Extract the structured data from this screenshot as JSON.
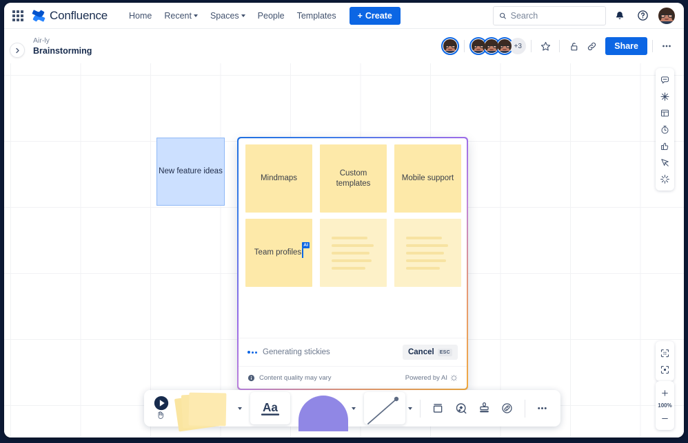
{
  "nav": {
    "brand": "Confluence",
    "apps_icon": "apps-grid-icon",
    "links": [
      {
        "label": "Home",
        "has_caret": false
      },
      {
        "label": "Recent",
        "has_caret": true
      },
      {
        "label": "Spaces",
        "has_caret": true
      },
      {
        "label": "People",
        "has_caret": false
      },
      {
        "label": "Templates",
        "has_caret": false
      }
    ],
    "create_label": "Create",
    "search_placeholder": "Search",
    "search_value": "",
    "notification_icon": "bell-icon",
    "help_icon": "help-icon",
    "profile_icon": "avatar"
  },
  "subheader": {
    "expand_icon": "chevron-right-icon",
    "breadcrumb": "Air-ly",
    "title": "Brainstorming",
    "collaborator_count_badge": "+3",
    "star_icon": "star-icon",
    "restrictions_icon": "lock-icon",
    "copy_link_icon": "link-icon",
    "share_label": "Share",
    "more_icon": "more-horizontal-icon"
  },
  "canvas": {
    "blue_sticky": "New feature ideas",
    "zoom_level": "100%"
  },
  "ai_panel": {
    "notes": [
      {
        "text": "Mindmaps",
        "state": "filled"
      },
      {
        "text": "Custom templates",
        "state": "filled"
      },
      {
        "text": "Mobile support",
        "state": "filled"
      },
      {
        "text": "Team profiles",
        "state": "filled",
        "cursor": true,
        "cursor_label": "AI"
      },
      {
        "text": "",
        "state": "ghost"
      },
      {
        "text": "",
        "state": "ghost"
      }
    ],
    "status_text": "Generating stickies",
    "cancel_label": "Cancel",
    "cancel_shortcut": "ESC",
    "disclaimer": "Content quality may vary",
    "powered_by": "Powered by AI",
    "gradient_from": "#1f6fe0",
    "gradient_to": "#f0a93f"
  },
  "right_rail": {
    "tools": [
      "comment-icon",
      "sparkle-star-icon",
      "template-layout-icon",
      "timer-icon",
      "thumbs-up-icon",
      "presenter-cursor-icon",
      "ai-sparkle-icon"
    ],
    "fit": [
      "zoom-to-fit-icon",
      "zoom-to-selection-icon"
    ],
    "zoom_in": "+",
    "zoom_level": "100%",
    "zoom_out": "−"
  },
  "toolbar": {
    "items": [
      {
        "name": "select-tool",
        "icon": "cursor-play-icon",
        "caret": false
      },
      {
        "name": "sticky-tool",
        "icon": "sticky-notes-icon",
        "caret": true
      },
      {
        "name": "text-tool",
        "icon": "text-aa-icon",
        "caret": false
      },
      {
        "name": "shape-tool",
        "icon": "shape-icon",
        "caret": true
      },
      {
        "name": "line-tool",
        "icon": "line-icon",
        "caret": true
      },
      {
        "name": "frame-tool",
        "icon": "frame-icon",
        "caret": false
      },
      {
        "name": "jira-tool",
        "icon": "jira-search-icon",
        "caret": false
      },
      {
        "name": "stamp-tool",
        "icon": "stamp-icon",
        "caret": false
      },
      {
        "name": "link-tool",
        "icon": "link-chain-icon",
        "caret": false
      },
      {
        "name": "more-tool",
        "icon": "more-horizontal-icon",
        "caret": false
      }
    ]
  }
}
